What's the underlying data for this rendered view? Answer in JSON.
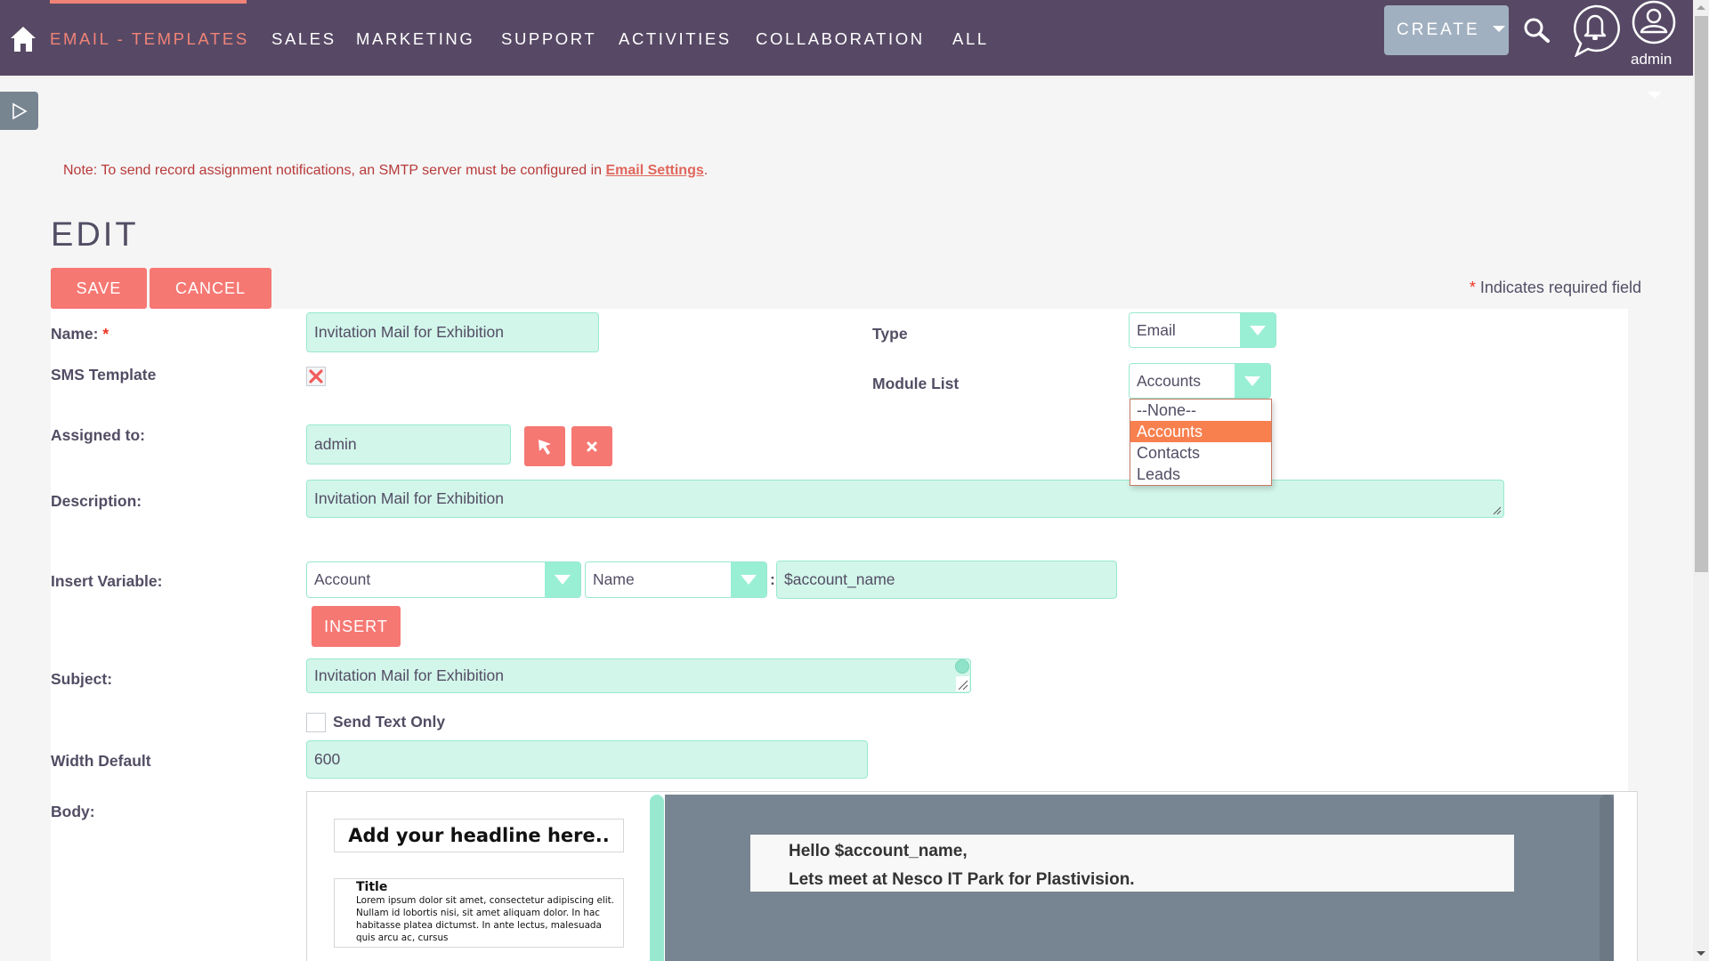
{
  "header": {
    "home_icon": "home-icon",
    "active_tab": "EMAIL - TEMPLATES",
    "nav_items": [
      "SALES",
      "MARKETING",
      "SUPPORT",
      "ACTIVITIES",
      "COLLABORATION",
      "ALL"
    ],
    "create_label": "CREATE",
    "search_icon": "search-icon",
    "notifications_icon": "bell-icon",
    "user_icon": "user-avatar-icon",
    "user_name": "admin",
    "colors": {
      "bar": "#574965",
      "active": "#f08377",
      "create_bg": "#a1b0c0"
    }
  },
  "sidebar_toggle_icon": "play-triangle-icon",
  "note": {
    "text": "Note: To send record assignment notifications, an SMTP server must be configured in ",
    "link": "Email Settings",
    "suffix": "."
  },
  "page": {
    "title": "EDIT",
    "save_label": "SAVE",
    "cancel_label": "CANCEL",
    "required_note": "Indicates required field",
    "required_star": "*"
  },
  "form": {
    "name": {
      "label": "Name:",
      "required": "*",
      "value": "Invitation Mail for Exhibition"
    },
    "type": {
      "label": "Type",
      "value": "Email"
    },
    "sms_template": {
      "label": "SMS Template",
      "checked": false
    },
    "module_list": {
      "label": "Module List",
      "value": "Accounts",
      "options": [
        "--None--",
        "Accounts",
        "Contacts",
        "Leads"
      ],
      "selected_index": 1,
      "open": true
    },
    "assigned_to": {
      "label": "Assigned to:",
      "value": "admin",
      "select_icon": "cursor-arrow-icon",
      "clear_icon": "close-icon"
    },
    "description": {
      "label": "Description:",
      "value": "Invitation Mail for Exhibition"
    },
    "insert_variable": {
      "label": "Insert Variable:",
      "module_value": "Account",
      "field_value": "Name",
      "separator": ":",
      "variable_value": "$account_name",
      "insert_label": "INSERT"
    },
    "subject": {
      "label": "Subject:",
      "value": "Invitation Mail for Exhibition"
    },
    "send_text_only": {
      "label": "Send Text Only",
      "checked": false
    },
    "width_default": {
      "label": "Width Default",
      "value": "600"
    },
    "body": {
      "label": "Body:",
      "blocks": {
        "headline": "Add your headline here..",
        "title": "Title",
        "paragraph": "Lorem ipsum dolor sit amet, consectetur adipiscing elit. Nullam id lobortis nisi, sit amet aliquam dolor. In hac habitasse platea dictumst. In ante lectus, malesuada quis arcu ac, cursus"
      },
      "content_lines": [
        "Hello $account_name,",
        "Lets meet at Nesco IT Park for Plastivision."
      ]
    }
  },
  "colors": {
    "input_bg": "#d2f6ea",
    "input_border": "#98e8d0",
    "button_red": "#f67873",
    "dropdown_selected": "#f8804f",
    "canvas": "#778491"
  }
}
